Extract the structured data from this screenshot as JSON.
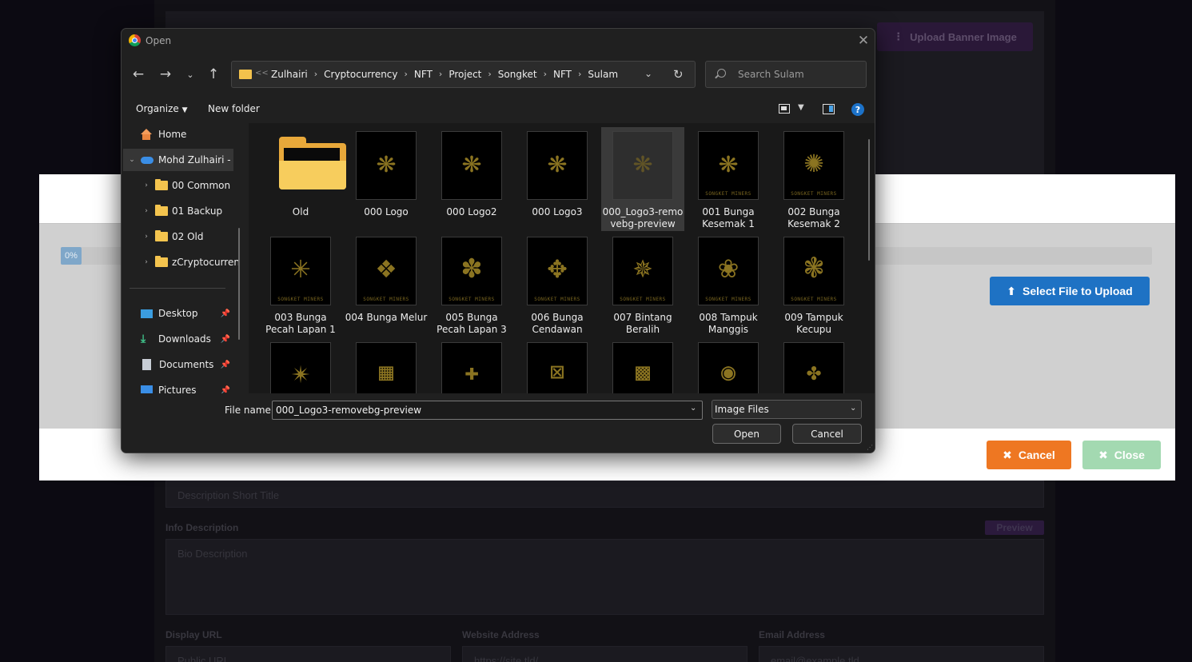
{
  "background_page": {
    "upload_banner_label": "Upload Banner Image",
    "short_title_placeholder": "Description Short Title",
    "info_description_label": "Info Description",
    "preview_label": "Preview",
    "bio_placeholder": "Bio Description",
    "display_url_label": "Display URL",
    "display_url_placeholder": "Public URL",
    "website_label": "Website Address",
    "website_placeholder": "https://site.tld/",
    "email_label": "Email Address",
    "email_placeholder": "email@example.tld"
  },
  "upload_modal": {
    "progress_percent": 0,
    "progress_text": "0%",
    "select_file_label": "Select File to Upload",
    "cancel_label": "Cancel",
    "close_label": "Close",
    "colors": {
      "select": "#1e72c4",
      "cancel": "#ee7722",
      "close": "#a3d9b1"
    }
  },
  "dialog": {
    "title": "Open",
    "address": {
      "overflow": "<<",
      "crumbs": [
        "Zulhairi",
        "Cryptocurrency",
        "NFT",
        "Project",
        "Songket",
        "NFT",
        "Sulam"
      ]
    },
    "search_placeholder": "Search Sulam",
    "toolbar": {
      "organize": "Organize",
      "new_folder": "New folder"
    },
    "nav": {
      "home": "Home",
      "onedrive": "Mohd Zulhairi -",
      "folders": [
        "00 Common",
        "01 Backup",
        "02 Old",
        "zCryptocurren"
      ],
      "quick": [
        "Desktop",
        "Downloads",
        "Documents",
        "Pictures"
      ]
    },
    "files": [
      {
        "name": "Old",
        "type": "folder"
      },
      {
        "name": "000 Logo",
        "type": "image"
      },
      {
        "name": "000 Logo2",
        "type": "image"
      },
      {
        "name": "000 Logo3",
        "type": "image"
      },
      {
        "name": "000_Logo3-remo vebg-preview",
        "type": "image",
        "selected": true
      },
      {
        "name": "001 Bunga Kesemak 1",
        "type": "image"
      },
      {
        "name": "002 Bunga Kesemak 2",
        "type": "image"
      },
      {
        "name": "003 Bunga Pecah Lapan 1",
        "type": "image"
      },
      {
        "name": "004 Bunga Melur",
        "type": "image"
      },
      {
        "name": "005 Bunga Pecah Lapan 3",
        "type": "image"
      },
      {
        "name": "006 Bunga Cendawan",
        "type": "image"
      },
      {
        "name": "007 Bintang Beralih",
        "type": "image"
      },
      {
        "name": "008 Tampuk Manggis",
        "type": "image"
      },
      {
        "name": "009 Tampuk Kecupu",
        "type": "image"
      }
    ],
    "thumb_brand": "SONGKET MINERS",
    "file_name_label": "File name:",
    "file_name_value": "000_Logo3-removebg-preview",
    "file_type": "Image Files",
    "open_label": "Open",
    "cancel_label": "Cancel",
    "accent": "#8b7421"
  }
}
